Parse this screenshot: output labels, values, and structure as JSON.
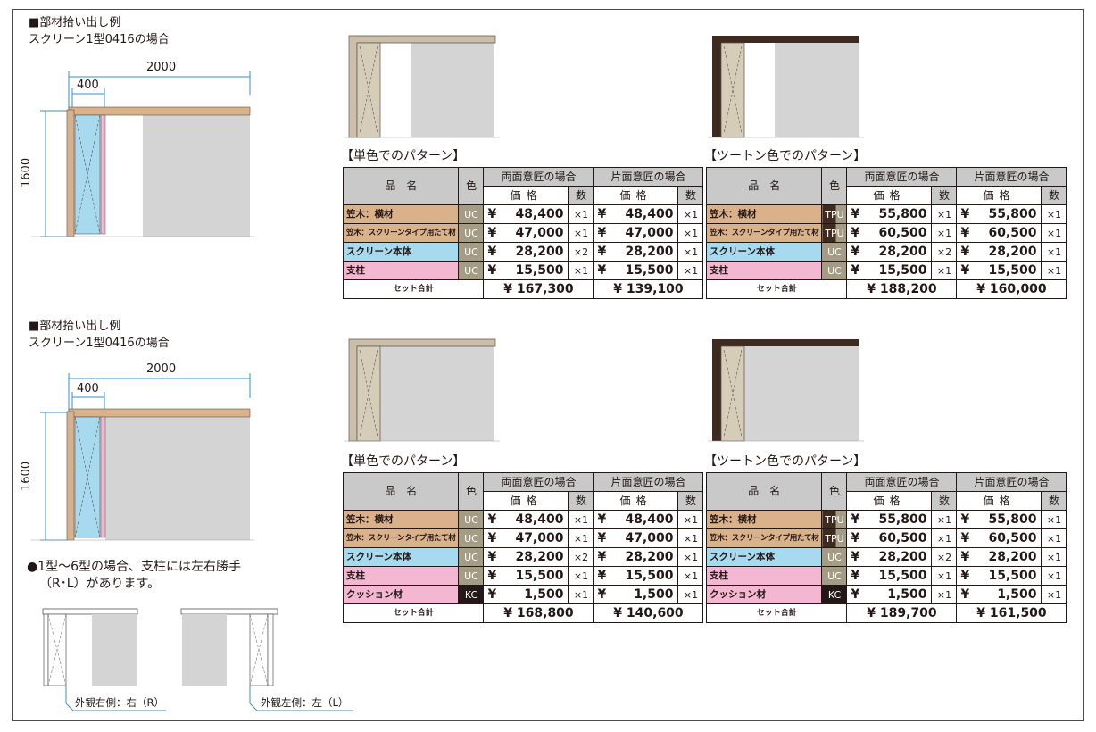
{
  "left": {
    "sections": [
      {
        "heading": "■部材拾い出し例",
        "subheading": "スクリーン1型0416の場合",
        "dim_width": "2000",
        "dim_screen": "400",
        "dim_height": "1600"
      },
      {
        "heading": "■部材拾い出し例",
        "subheading": "スクリーン1型0416の場合",
        "dim_width": "2000",
        "dim_screen": "400",
        "dim_height": "1600"
      }
    ],
    "note_line1": "●1型～6型の場合、支柱には左右勝手",
    "note_line2": "（R･L）があります。",
    "caption_right": "外観右側：右（R）",
    "caption_left": "外観左側：左（L）"
  },
  "table_header": {
    "name": "品　名",
    "color": "色",
    "double_sided": "両面意匠の場合",
    "single_sided": "片面意匠の場合",
    "price": "価格",
    "qty": "数",
    "total_label": "セット合計",
    "yen": "¥"
  },
  "tables": [
    {
      "title": "【単色でのパターン】",
      "rows": [
        {
          "name": "笠木：横材",
          "color": "UC",
          "p1": "48,400",
          "q1": "×1",
          "p2": "48,400",
          "q2": "×1"
        },
        {
          "name": "笠木：スクリーンタイプ用たて材",
          "color": "UC",
          "p1": "47,000",
          "q1": "×1",
          "p2": "47,000",
          "q2": "×1"
        },
        {
          "name": "スクリーン本体",
          "color": "UC",
          "p1": "28,200",
          "q1": "×2",
          "p2": "28,200",
          "q2": "×1"
        },
        {
          "name": "支柱",
          "color": "UC",
          "p1": "15,500",
          "q1": "×1",
          "p2": "15,500",
          "q2": "×1"
        }
      ],
      "total1": "¥ 167,300",
      "total2": "¥ 139,100"
    },
    {
      "title": "【ツートン色でのパターン】",
      "rows": [
        {
          "name": "笠木：横材",
          "color": "TPU",
          "p1": "55,800",
          "q1": "×1",
          "p2": "55,800",
          "q2": "×1"
        },
        {
          "name": "笠木：スクリーンタイプ用たて材",
          "color": "TPU",
          "p1": "60,500",
          "q1": "×1",
          "p2": "60,500",
          "q2": "×1"
        },
        {
          "name": "スクリーン本体",
          "color": "UC",
          "p1": "28,200",
          "q1": "×2",
          "p2": "28,200",
          "q2": "×1"
        },
        {
          "name": "支柱",
          "color": "UC",
          "p1": "15,500",
          "q1": "×1",
          "p2": "15,500",
          "q2": "×1"
        }
      ],
      "total1": "¥ 188,200",
      "total2": "¥ 160,000"
    },
    {
      "title": "【単色でのパターン】",
      "rows": [
        {
          "name": "笠木：横材",
          "color": "UC",
          "p1": "48,400",
          "q1": "×1",
          "p2": "48,400",
          "q2": "×1"
        },
        {
          "name": "笠木：スクリーンタイプ用たて材",
          "color": "UC",
          "p1": "47,000",
          "q1": "×1",
          "p2": "47,000",
          "q2": "×1"
        },
        {
          "name": "スクリーン本体",
          "color": "UC",
          "p1": "28,200",
          "q1": "×2",
          "p2": "28,200",
          "q2": "×1"
        },
        {
          "name": "支柱",
          "color": "UC",
          "p1": "15,500",
          "q1": "×1",
          "p2": "15,500",
          "q2": "×1"
        },
        {
          "name": "クッション材",
          "color": "KC",
          "p1": "1,500",
          "q1": "×1",
          "p2": "1,500",
          "q2": "×1"
        }
      ],
      "total1": "¥ 168,800",
      "total2": "¥ 140,600"
    },
    {
      "title": "【ツートン色でのパターン】",
      "rows": [
        {
          "name": "笠木：横材",
          "color": "TPU",
          "p1": "55,800",
          "q1": "×1",
          "p2": "55,800",
          "q2": "×1"
        },
        {
          "name": "笠木：スクリーンタイプ用たて材",
          "color": "TPU",
          "p1": "60,500",
          "q1": "×1",
          "p2": "60,500",
          "q2": "×1"
        },
        {
          "name": "スクリーン本体",
          "color": "UC",
          "p1": "28,200",
          "q1": "×2",
          "p2": "28,200",
          "q2": "×1"
        },
        {
          "name": "支柱",
          "color": "UC",
          "p1": "15,500",
          "q1": "×1",
          "p2": "15,500",
          "q2": "×1"
        },
        {
          "name": "クッション材",
          "color": "KC",
          "p1": "1,500",
          "q1": "×1",
          "p2": "1,500",
          "q2": "×1"
        }
      ],
      "total1": "¥ 189,700",
      "total2": "¥ 161,500"
    }
  ],
  "colors": {
    "beam_tan": "#d9b18b",
    "screen_blue": "#a7d9ef",
    "post_pink": "#f4b7d1",
    "uc_gray": "#a59c86",
    "kc_black": "#231815",
    "tpu_brown": "#3e2a1f",
    "wall_gray": "#d4d4d4",
    "header_gray": "#c9c9c9"
  }
}
